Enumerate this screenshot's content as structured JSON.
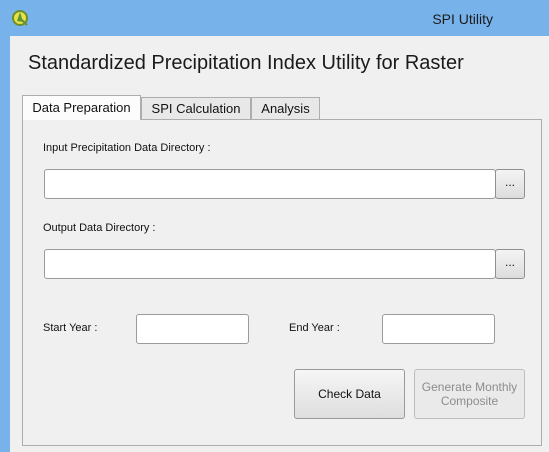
{
  "window": {
    "title": "SPI Utility"
  },
  "heading": "Standardized Precipitation Index Utility for Raster",
  "tabs": [
    {
      "label": "Data Preparation",
      "active": true
    },
    {
      "label": "SPI Calculation",
      "active": false
    },
    {
      "label": "Analysis",
      "active": false
    }
  ],
  "form": {
    "input_dir": {
      "label": "Input Precipitation Data Directory :",
      "value": "",
      "browse_label": "..."
    },
    "output_dir": {
      "label": "Output Data Directory :",
      "value": "",
      "browse_label": "..."
    },
    "start_year": {
      "label": "Start Year :",
      "value": ""
    },
    "end_year": {
      "label": "End Year :",
      "value": ""
    }
  },
  "buttons": {
    "check_data": "Check Data",
    "generate_monthly": "Generate Monthly Composite"
  },
  "colors": {
    "titlebar": "#77b2ea",
    "client": "#f0f0f0"
  }
}
